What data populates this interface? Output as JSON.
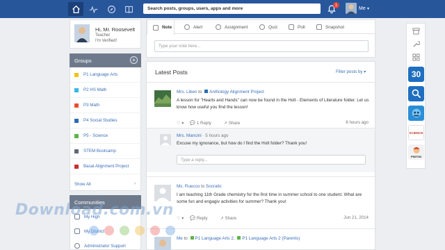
{
  "topbar": {
    "search_placeholder": "Search posts, groups, users, apps and more",
    "notification_count": "1",
    "me_label": "Me"
  },
  "profile": {
    "name": "Hi, Mr. Roosevelt",
    "role": "Teacher",
    "verified": "I'm Verified!"
  },
  "groups": {
    "title": "Groups",
    "items": [
      {
        "label": "P1 Language Arts",
        "color": "#f2c21b"
      },
      {
        "label": "P2 HS Math",
        "color": "#37b7e8"
      },
      {
        "label": "P3 Math",
        "color": "#e8502d"
      },
      {
        "label": "P4 Social Studies",
        "color": "#2a6bb5"
      },
      {
        "label": "P5 - Science",
        "color": "#5cb646"
      },
      {
        "label": "STEM Bootcamp",
        "color": "#5d6a78"
      },
      {
        "label": "Basal Alignment Project",
        "color": "#c9302c"
      }
    ],
    "show_all": "Show All"
  },
  "communities": {
    "title": "Communities",
    "items": [
      "My High",
      "My District",
      "Administrator Support"
    ]
  },
  "composer": {
    "tabs": [
      "Note",
      "Alert",
      "Assignment",
      "Quiz",
      "Poll",
      "Snapshot"
    ],
    "placeholder": "Type your note here..."
  },
  "feed": {
    "title": "Latest Posts",
    "filter_label": "Filter posts by",
    "posts": [
      {
        "author": "Mrs. Liben",
        "to_word": "to",
        "group": "Anthology Alignment Project",
        "body": "A lesson for \"Hearts and Hands\" can now be found in the Holt - Elements of Literature folder. Let us know how useful you find the lesson!",
        "reply_label": "1 Reply",
        "share_label": "Share",
        "date": "6 hours ago",
        "reply": {
          "author": "Mrs. Mancini",
          "time": "5 hours ago",
          "body": "Excuse my ignorance, but how do I find the Holt folder? Thank you!"
        },
        "reply_placeholder": "Type a reply..."
      },
      {
        "author": "Ms. Ruecco",
        "to_word": "to",
        "group": "Socratic",
        "body": "I am teaching 11th Grade chemistry for the first time in summer school to one student. What are some fun and engagiv activities for summer? Thank you!",
        "reply_label": "Reply",
        "share_label": "Share",
        "date": "Jun 21, 2014"
      },
      {
        "author": "Me",
        "to_word": "to",
        "groups": [
          "P1 Language Arts 2",
          "P1 Language Arts 2 (Parents)"
        ]
      }
    ]
  },
  "right_rail": {
    "tile_30_label": "30",
    "tile_title_label": "SCIENCE",
    "tile_pinton_label": "PINTON"
  },
  "watermark": "Download.com.vn"
}
